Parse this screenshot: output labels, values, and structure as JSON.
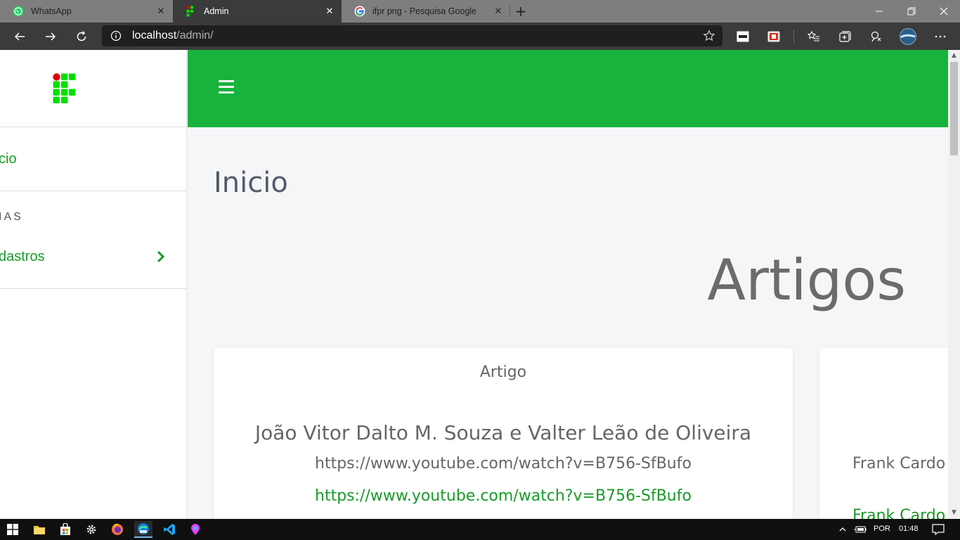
{
  "browser": {
    "tabs": [
      {
        "title": "WhatsApp",
        "icon": "whatsapp-icon",
        "active": false
      },
      {
        "title": "Admin",
        "icon": "ifpr-icon",
        "active": true
      },
      {
        "title": "ifpr png - Pesquisa Google",
        "icon": "google-icon",
        "active": false
      }
    ],
    "address": {
      "host": "localhost",
      "path": "/admin/"
    }
  },
  "sidebar": {
    "home_label": "cio",
    "section_label": "IAS",
    "items": [
      {
        "label": "dastros",
        "icon": "chevron-right-icon"
      }
    ]
  },
  "main": {
    "page_title": "Inicio",
    "section_title": "Artigos",
    "cards": [
      {
        "type": "Artigo",
        "author": "João Vitor Dalto M. Souza e Valter Leão de Oliveira",
        "url_text": "https://www.youtube.com/watch?v=B756-SfBufo",
        "link": "https://www.youtube.com/watch?v=B756-SfBufo"
      },
      {
        "type": "",
        "author": "Frank Cardo",
        "link": "Frank Cardo"
      }
    ]
  },
  "taskbar": {
    "language": "POR",
    "time": "01:48"
  },
  "colors": {
    "brand_green": "#17b33c",
    "link_green": "#1a9a2a",
    "logo_green": "#00e000",
    "logo_red": "#e00000"
  }
}
